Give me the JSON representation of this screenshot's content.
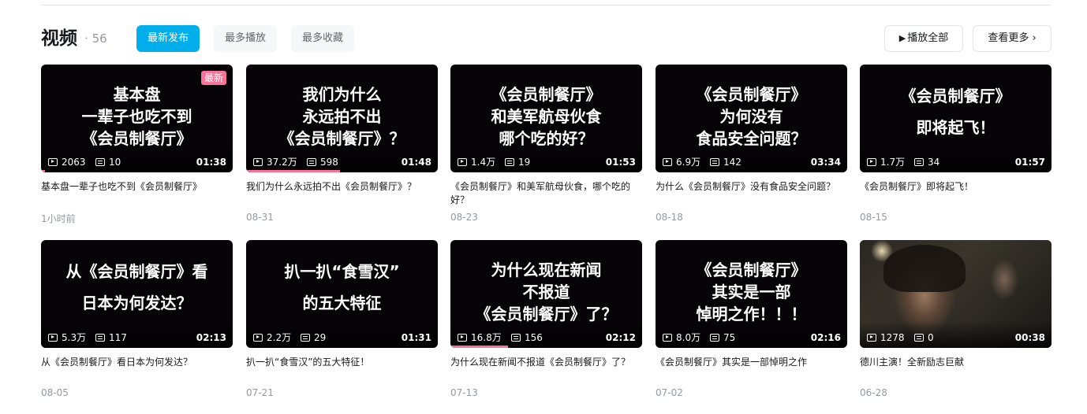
{
  "header": {
    "title": "视频",
    "separator": "·",
    "count": "56",
    "sort_tabs": [
      "最新发布",
      "最多播放",
      "最多收藏"
    ],
    "active_tab": "最新发布",
    "play_all_icon": "▶",
    "play_all_label": "播放全部",
    "see_more_label": "查看更多",
    "see_more_icon": "›"
  },
  "videos": [
    {
      "thumb_lines": [
        "基本盘",
        "一辈子也吃不到",
        "《会员制餐厅》"
      ],
      "badge": "最新",
      "plays": "2063",
      "danmaku": "10",
      "duration": "01:38",
      "watch_progress_pct": 2,
      "title": "基本盘一辈子也吃不到《会员制餐厅》",
      "date": "1小时前"
    },
    {
      "thumb_lines": [
        "我们为什么",
        "永远拍不出",
        "《会员制餐厅》？"
      ],
      "plays": "37.2万",
      "danmaku": "598",
      "duration": "01:48",
      "watch_progress_pct": 49,
      "title": "我们为什么永远拍不出《会员制餐厅》？",
      "date": "08-31"
    },
    {
      "thumb_lines": [
        "《会员制餐厅》",
        "和美军航母伙食",
        "哪个吃的好？"
      ],
      "plays": "1.4万",
      "danmaku": "19",
      "duration": "01:53",
      "title": "《会员制餐厅》和美军航母伙食，哪个吃的好？",
      "date": "08-23"
    },
    {
      "thumb_lines": [
        "《会员制餐厅》",
        "为何没有",
        "食品安全问题？"
      ],
      "plays": "6.9万",
      "danmaku": "142",
      "duration": "03:34",
      "title": "为什么《会员制餐厅》没有食品安全问题？",
      "date": "08-18"
    },
    {
      "thumb_lines": [
        "《会员制餐厅》",
        "即将起飞！"
      ],
      "plays": "1.7万",
      "danmaku": "34",
      "duration": "01:57",
      "title": "《会员制餐厅》即将起飞！",
      "date": "08-15"
    },
    {
      "thumb_lines": [
        "从《会员制餐厅》看",
        "日本为何发达？"
      ],
      "plays": "5.3万",
      "danmaku": "117",
      "duration": "02:13",
      "title": "从《会员制餐厅》看日本为何发达？",
      "date": "08-05"
    },
    {
      "thumb_lines": [
        "扒一扒“食雪汉”",
        "的五大特征"
      ],
      "plays": "2.2万",
      "danmaku": "29",
      "duration": "01:31",
      "title": "扒一扒“食雪汉”的五大特征！",
      "date": "07-21"
    },
    {
      "thumb_lines": [
        "为什么现在新闻",
        "不报道",
        "《会员制餐厅》了？"
      ],
      "plays": "16.8万",
      "danmaku": "156",
      "duration": "02:12",
      "watch_progress_pct": 30,
      "title": "为什么现在新闻不报道《会员制餐厅》了？",
      "date": "07-13"
    },
    {
      "thumb_lines": [
        "《会员制餐厅》",
        "其实是一部",
        "悼明之作！！！"
      ],
      "plays": "8.0万",
      "danmaku": "75",
      "duration": "02:16",
      "title": "《会员制餐厅》其实是一部悼明之作",
      "date": "07-02"
    },
    {
      "thumb_lines": [],
      "photo": true,
      "plays": "1278",
      "danmaku": "0",
      "duration": "00:38",
      "title": "德川主演！全新励志巨献",
      "date": "06-28"
    }
  ],
  "icons": {
    "play_count": "play-count-icon",
    "danmaku": "danmaku-icon"
  },
  "colors": {
    "accent": "#00aeec",
    "badge": "#fb7299",
    "thumb_bg": "#060406"
  }
}
